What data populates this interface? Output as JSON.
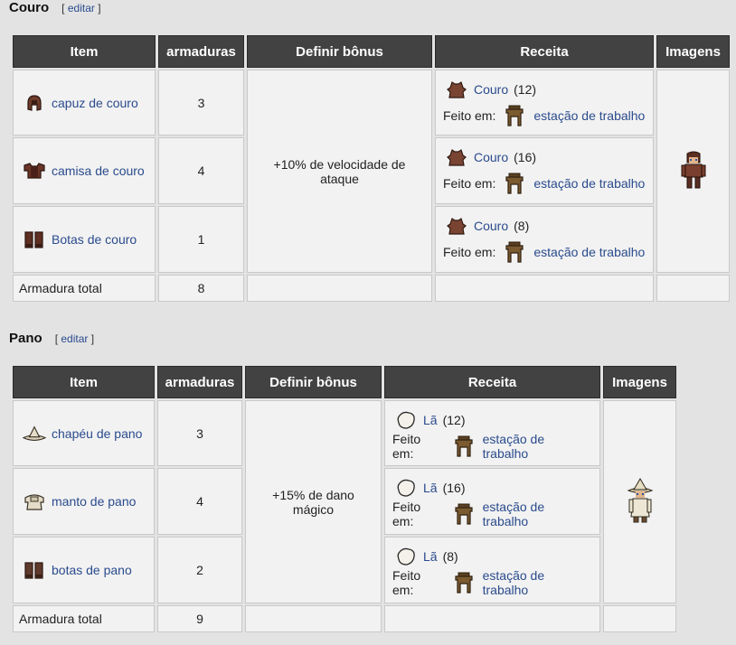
{
  "sections": [
    {
      "title": "Couro",
      "edit_label": "editar",
      "headers": [
        "Item",
        "armaduras",
        "Definir bônus",
        "Receita",
        "Imagens"
      ],
      "rows": [
        {
          "name": "capuz de couro",
          "armor": "3",
          "material": "Couro",
          "qty": "(12)",
          "made_at_label": "Feito em:",
          "station": "estação de trabalho",
          "item_icon": "leather-hood-icon"
        },
        {
          "name": "camisa de couro",
          "armor": "4",
          "material": "Couro",
          "qty": "(16)",
          "made_at_label": "Feito em:",
          "station": "estação de trabalho",
          "item_icon": "leather-shirt-icon"
        },
        {
          "name": "Botas de couro",
          "armor": "1",
          "material": "Couro",
          "qty": "(8)",
          "made_at_label": "Feito em:",
          "station": "estação de trabalho",
          "item_icon": "leather-boots-icon"
        }
      ],
      "bonus": "+10% de velocidade de ataque",
      "total_label": "Armadura total",
      "total_value": "8",
      "preview_icon": "leather-armor-character-icon"
    },
    {
      "title": "Pano",
      "edit_label": "editar",
      "headers": [
        "Item",
        "armaduras",
        "Definir bônus",
        "Receita",
        "Imagens"
      ],
      "rows": [
        {
          "name": "chapéu de pano",
          "armor": "3",
          "material": "Lã",
          "qty": "(12)",
          "made_at_label": "Feito em:",
          "station": "estação de trabalho",
          "item_icon": "cloth-hat-icon"
        },
        {
          "name": "manto de pano",
          "armor": "4",
          "material": "Lã",
          "qty": "(16)",
          "made_at_label": "Feito em:",
          "station": "estação de trabalho",
          "item_icon": "cloth-robe-icon"
        },
        {
          "name": "botas de pano",
          "armor": "2",
          "material": "Lã",
          "qty": "(8)",
          "made_at_label": "Feito em:",
          "station": "estação de trabalho",
          "item_icon": "cloth-boots-icon"
        }
      ],
      "bonus": "+15% de dano mágico",
      "total_label": "Armadura total",
      "total_value": "9",
      "preview_icon": "cloth-armor-character-icon"
    }
  ],
  "colors": {
    "header_bg": "#424242",
    "cell_bg": "#f2f2f2",
    "link": "#2a4b8d",
    "page_bg": "#e3e3e3"
  }
}
